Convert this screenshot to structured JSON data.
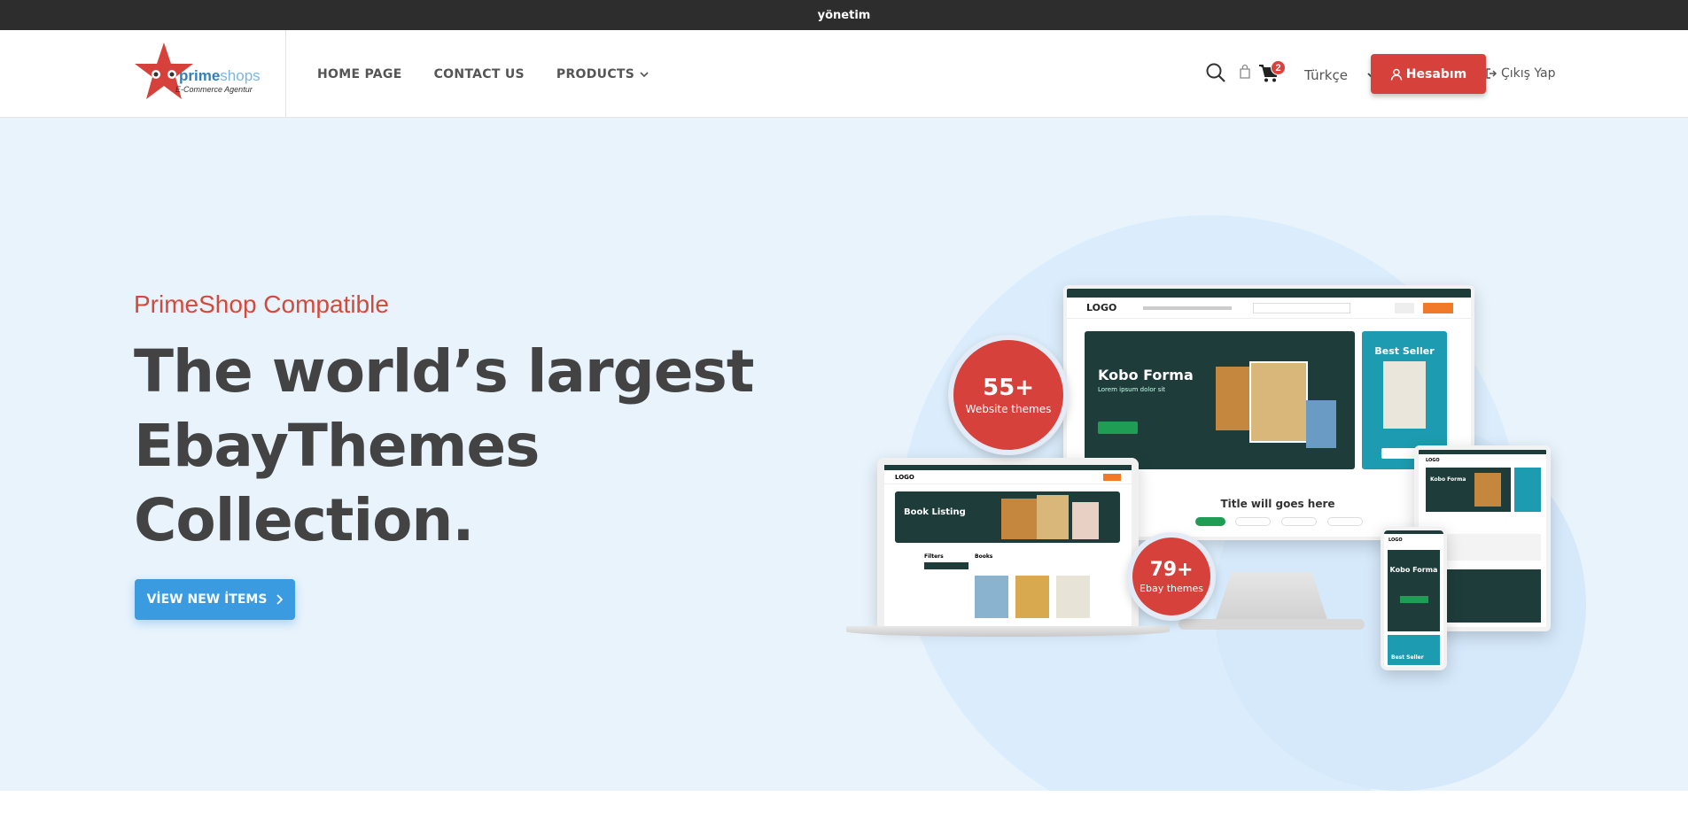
{
  "topbar": {
    "title": "yönetim"
  },
  "logo": {
    "brand_primary": "prime",
    "brand_secondary": "shops",
    "tagline": "E-Commerce Agentur"
  },
  "nav": {
    "home": "HOME PAGE",
    "contact": "CONTACT US",
    "products": "PRODUCTS"
  },
  "tools": {
    "search_icon": "search-icon",
    "bag_icon": "bag-icon",
    "cart_icon": "cart-icon",
    "cart_count": "2",
    "language": "Türkçe",
    "account_label": "Hesabım",
    "logout_label": "Çıkış Yap"
  },
  "hero": {
    "subtitle": "PrimeShop Compatible",
    "title_line1": "The world’s largest",
    "title_line2": "EbayThemes",
    "title_line3": "Collection.",
    "button_label": "VİEW NEW İTEMS"
  },
  "mockup": {
    "badge1_num": "55+",
    "badge1_text": "Website themes",
    "badge2_num": "79+",
    "badge2_text": "Ebay themes",
    "monitor_logo": "LOGO",
    "monitor_banner_title": "Kobo Forma",
    "monitor_banner_text": "Lorem ipsum dolor sit",
    "monitor_side_title": "Best Seller",
    "monitor_section_title": "Title will goes here",
    "laptop_banner_title": "Book Listing",
    "laptop_filters": "Filters",
    "laptop_books": "Books",
    "phone_title": "Kobo Forma",
    "phone_best": "Best Seller",
    "phone_logo": "LOGO",
    "tablet_logo": "LOGO",
    "tablet_title": "Kobo Forma"
  },
  "colors": {
    "accent_red": "#d6413c",
    "accent_blue": "#3a9be0",
    "hero_bg": "#e8f3fc",
    "dark_teal": "#1e3d3a",
    "teal": "#1d9bb0"
  }
}
